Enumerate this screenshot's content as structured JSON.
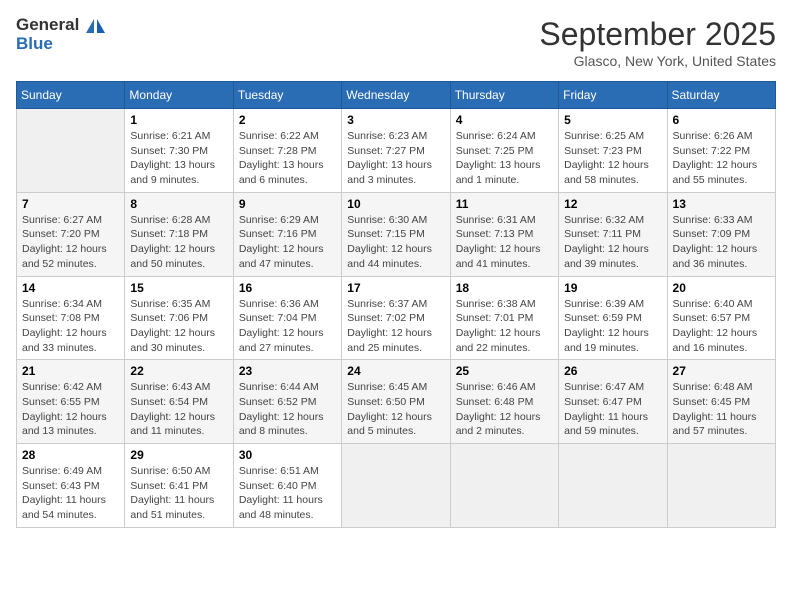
{
  "header": {
    "logo_line1": "General",
    "logo_line2": "Blue",
    "month_title": "September 2025",
    "subtitle": "Glasco, New York, United States"
  },
  "weekdays": [
    "Sunday",
    "Monday",
    "Tuesday",
    "Wednesday",
    "Thursday",
    "Friday",
    "Saturday"
  ],
  "weeks": [
    [
      {
        "day": "",
        "info": ""
      },
      {
        "day": "1",
        "info": "Sunrise: 6:21 AM\nSunset: 7:30 PM\nDaylight: 13 hours\nand 9 minutes."
      },
      {
        "day": "2",
        "info": "Sunrise: 6:22 AM\nSunset: 7:28 PM\nDaylight: 13 hours\nand 6 minutes."
      },
      {
        "day": "3",
        "info": "Sunrise: 6:23 AM\nSunset: 7:27 PM\nDaylight: 13 hours\nand 3 minutes."
      },
      {
        "day": "4",
        "info": "Sunrise: 6:24 AM\nSunset: 7:25 PM\nDaylight: 13 hours\nand 1 minute."
      },
      {
        "day": "5",
        "info": "Sunrise: 6:25 AM\nSunset: 7:23 PM\nDaylight: 12 hours\nand 58 minutes."
      },
      {
        "day": "6",
        "info": "Sunrise: 6:26 AM\nSunset: 7:22 PM\nDaylight: 12 hours\nand 55 minutes."
      }
    ],
    [
      {
        "day": "7",
        "info": "Sunrise: 6:27 AM\nSunset: 7:20 PM\nDaylight: 12 hours\nand 52 minutes."
      },
      {
        "day": "8",
        "info": "Sunrise: 6:28 AM\nSunset: 7:18 PM\nDaylight: 12 hours\nand 50 minutes."
      },
      {
        "day": "9",
        "info": "Sunrise: 6:29 AM\nSunset: 7:16 PM\nDaylight: 12 hours\nand 47 minutes."
      },
      {
        "day": "10",
        "info": "Sunrise: 6:30 AM\nSunset: 7:15 PM\nDaylight: 12 hours\nand 44 minutes."
      },
      {
        "day": "11",
        "info": "Sunrise: 6:31 AM\nSunset: 7:13 PM\nDaylight: 12 hours\nand 41 minutes."
      },
      {
        "day": "12",
        "info": "Sunrise: 6:32 AM\nSunset: 7:11 PM\nDaylight: 12 hours\nand 39 minutes."
      },
      {
        "day": "13",
        "info": "Sunrise: 6:33 AM\nSunset: 7:09 PM\nDaylight: 12 hours\nand 36 minutes."
      }
    ],
    [
      {
        "day": "14",
        "info": "Sunrise: 6:34 AM\nSunset: 7:08 PM\nDaylight: 12 hours\nand 33 minutes."
      },
      {
        "day": "15",
        "info": "Sunrise: 6:35 AM\nSunset: 7:06 PM\nDaylight: 12 hours\nand 30 minutes."
      },
      {
        "day": "16",
        "info": "Sunrise: 6:36 AM\nSunset: 7:04 PM\nDaylight: 12 hours\nand 27 minutes."
      },
      {
        "day": "17",
        "info": "Sunrise: 6:37 AM\nSunset: 7:02 PM\nDaylight: 12 hours\nand 25 minutes."
      },
      {
        "day": "18",
        "info": "Sunrise: 6:38 AM\nSunset: 7:01 PM\nDaylight: 12 hours\nand 22 minutes."
      },
      {
        "day": "19",
        "info": "Sunrise: 6:39 AM\nSunset: 6:59 PM\nDaylight: 12 hours\nand 19 minutes."
      },
      {
        "day": "20",
        "info": "Sunrise: 6:40 AM\nSunset: 6:57 PM\nDaylight: 12 hours\nand 16 minutes."
      }
    ],
    [
      {
        "day": "21",
        "info": "Sunrise: 6:42 AM\nSunset: 6:55 PM\nDaylight: 12 hours\nand 13 minutes."
      },
      {
        "day": "22",
        "info": "Sunrise: 6:43 AM\nSunset: 6:54 PM\nDaylight: 12 hours\nand 11 minutes."
      },
      {
        "day": "23",
        "info": "Sunrise: 6:44 AM\nSunset: 6:52 PM\nDaylight: 12 hours\nand 8 minutes."
      },
      {
        "day": "24",
        "info": "Sunrise: 6:45 AM\nSunset: 6:50 PM\nDaylight: 12 hours\nand 5 minutes."
      },
      {
        "day": "25",
        "info": "Sunrise: 6:46 AM\nSunset: 6:48 PM\nDaylight: 12 hours\nand 2 minutes."
      },
      {
        "day": "26",
        "info": "Sunrise: 6:47 AM\nSunset: 6:47 PM\nDaylight: 11 hours\nand 59 minutes."
      },
      {
        "day": "27",
        "info": "Sunrise: 6:48 AM\nSunset: 6:45 PM\nDaylight: 11 hours\nand 57 minutes."
      }
    ],
    [
      {
        "day": "28",
        "info": "Sunrise: 6:49 AM\nSunset: 6:43 PM\nDaylight: 11 hours\nand 54 minutes."
      },
      {
        "day": "29",
        "info": "Sunrise: 6:50 AM\nSunset: 6:41 PM\nDaylight: 11 hours\nand 51 minutes."
      },
      {
        "day": "30",
        "info": "Sunrise: 6:51 AM\nSunset: 6:40 PM\nDaylight: 11 hours\nand 48 minutes."
      },
      {
        "day": "",
        "info": ""
      },
      {
        "day": "",
        "info": ""
      },
      {
        "day": "",
        "info": ""
      },
      {
        "day": "",
        "info": ""
      }
    ]
  ]
}
